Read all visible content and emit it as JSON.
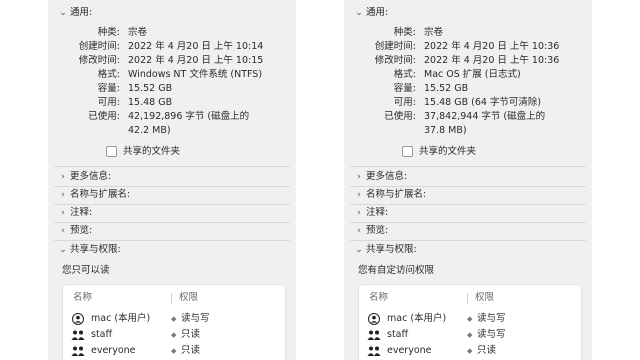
{
  "panels": [
    {
      "general_title": "通用:",
      "info": [
        {
          "label": "种类:",
          "value": "宗卷"
        },
        {
          "label": "创建时间:",
          "value": "2022 年 4 月20 日 上午 10:14"
        },
        {
          "label": "修改时间:",
          "value": "2022 年 4 月20 日 上午 10:15"
        },
        {
          "label": "格式:",
          "value": "Windows NT 文件系统 (NTFS)"
        },
        {
          "label": "容量:",
          "value": "15.52 GB"
        },
        {
          "label": "可用:",
          "value": "15.48 GB"
        },
        {
          "label": "已使用:",
          "value": "42,192,896 字节 (磁盘上的"
        },
        {
          "label": "",
          "value": "42.2 MB)"
        }
      ],
      "shared_folder_label": "共享的文件夹",
      "sections": [
        "更多信息:",
        "名称与扩展名:",
        "注释:",
        "预览:",
        "共享与权限:"
      ],
      "permission_summary": "您只可以读",
      "table_headers": {
        "name": "名称",
        "privilege": "权限"
      },
      "permissions": [
        {
          "user": "mac (本用户)",
          "privilege": "读与写"
        },
        {
          "user": "staff",
          "privilege": "只读"
        },
        {
          "user": "everyone",
          "privilege": "只读"
        }
      ]
    },
    {
      "general_title": "通用:",
      "info": [
        {
          "label": "种类:",
          "value": "宗卷"
        },
        {
          "label": "创建时间:",
          "value": "2022 年 4 月20 日 上午 10:36"
        },
        {
          "label": "修改时间:",
          "value": "2022 年 4 月20 日 上午 10:36"
        },
        {
          "label": "格式:",
          "value": "Mac OS 扩展 (日志式)"
        },
        {
          "label": "容量:",
          "value": "15.52 GB"
        },
        {
          "label": "可用:",
          "value": "15.48 GB (64 字节可清除)"
        },
        {
          "label": "已使用:",
          "value": "37,842,944 字节 (磁盘上的"
        },
        {
          "label": "",
          "value": "37.8 MB)"
        }
      ],
      "shared_folder_label": "共享的文件夹",
      "sections": [
        "更多信息:",
        "名称与扩展名:",
        "注释:",
        "预览:",
        "共享与权限:"
      ],
      "permission_summary": "您有自定访问权限",
      "table_headers": {
        "name": "名称",
        "privilege": "权限"
      },
      "permissions": [
        {
          "user": "mac (本用户)",
          "privilege": "读与写"
        },
        {
          "user": "staff",
          "privilege": "读与写"
        },
        {
          "user": "everyone",
          "privilege": "只读"
        }
      ]
    }
  ],
  "icons": {
    "expanded": "chevron-down-icon",
    "collapsed": "chevron-right-icon",
    "single_user": "user-icon",
    "group": "group-icon"
  }
}
